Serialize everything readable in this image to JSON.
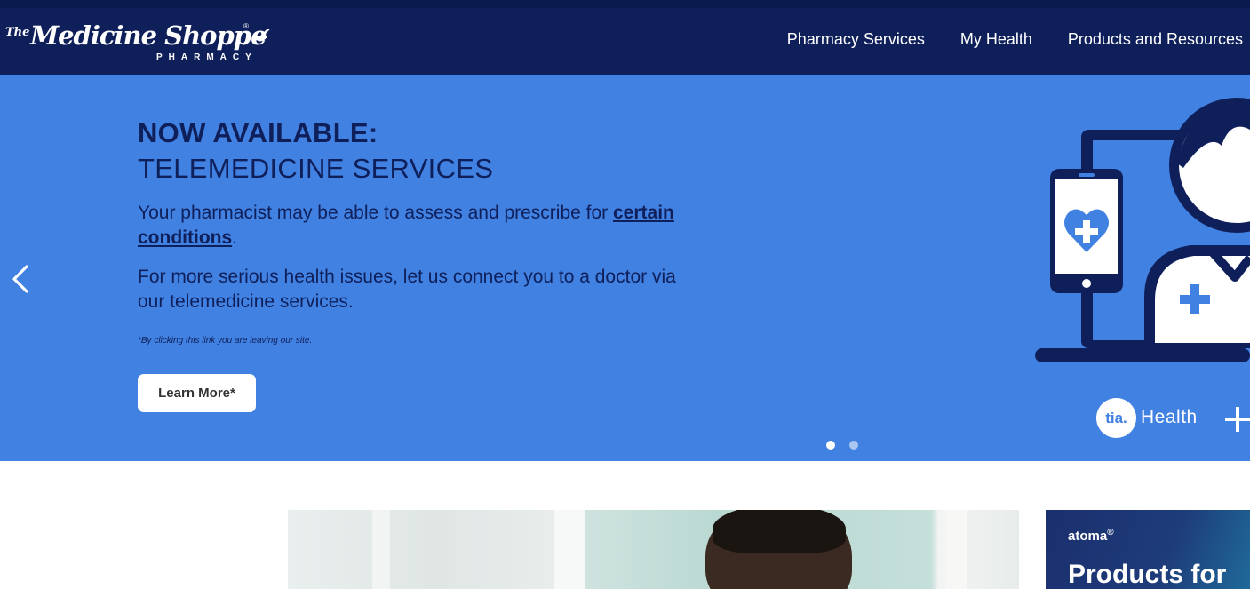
{
  "header": {
    "logo": {
      "the": "The",
      "name": "Medicine Shoppe",
      "registered": "®",
      "sub": "PHARMACY"
    },
    "nav": [
      {
        "label": "Pharmacy Services"
      },
      {
        "label": "My Health"
      },
      {
        "label": "Products and Resources"
      }
    ]
  },
  "hero": {
    "title": "NOW AVAILABLE:",
    "subtitle": "TELEMEDICINE SERVICES",
    "paragraph1_text": "Your pharmacist may be able to assess and prescribe for ",
    "paragraph1_link": "certain conditions",
    "paragraph1_end": ".",
    "paragraph2": "For more serious health issues, let us connect you to a doctor via our telemedicine services.",
    "note": "*By clicking this link you are leaving our site.",
    "button_label": "Learn More*",
    "carousel": {
      "slide_count": 2,
      "active_slide": 1
    },
    "partner": {
      "mark": "tia.",
      "name": "Health"
    },
    "icons": [
      "chevron-left-icon",
      "telemedicine-illustration",
      "heart-plus-icon",
      "plus-icon"
    ]
  },
  "promo": {
    "brand": "atoma",
    "brand_reg": "®",
    "title": "Products for"
  },
  "colors": {
    "header_bg": "#0f1f5a",
    "hero_bg": "#4181e2",
    "hero_text": "#0f1f5a",
    "button_bg": "#ffffff",
    "promo_bg": "#1b2f6e"
  }
}
